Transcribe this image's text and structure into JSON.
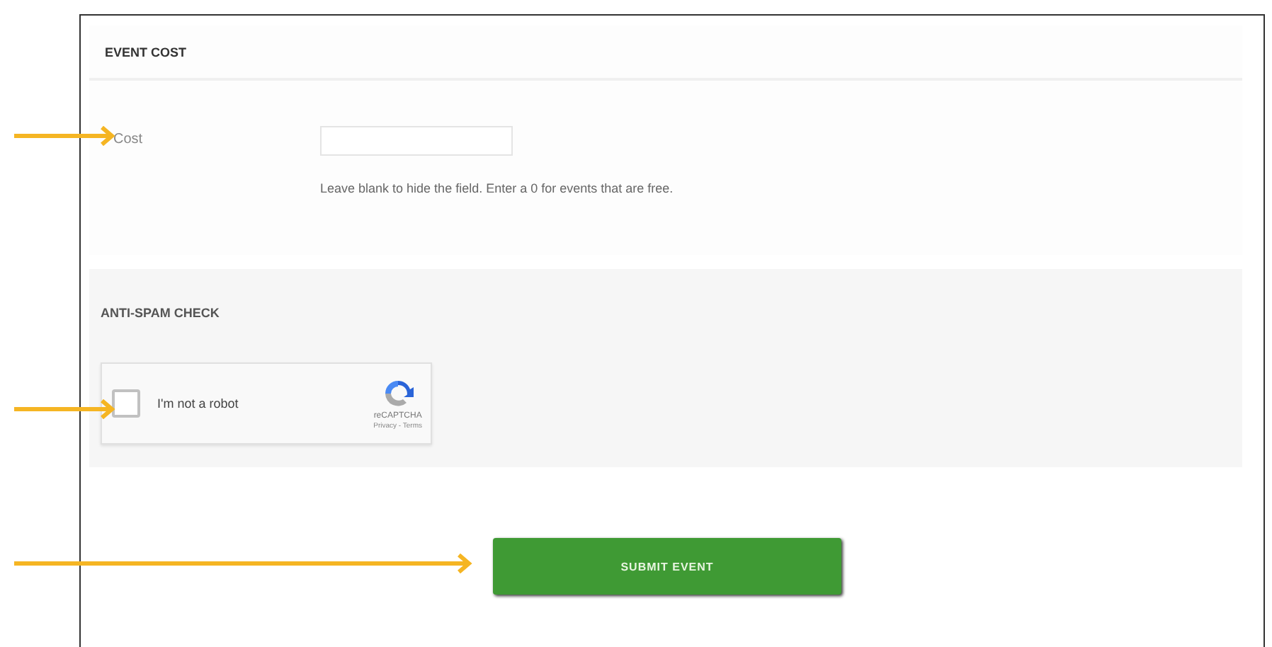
{
  "event_cost": {
    "title": "EVENT COST",
    "field": {
      "label": "Cost",
      "help": "Leave blank to hide the field. Enter a 0 for events that are free."
    }
  },
  "anti_spam": {
    "title": "ANTI-SPAM CHECK",
    "captcha": {
      "label": "I'm not a robot",
      "checked": false,
      "brand": "reCAPTCHA",
      "links": "Privacy - Terms"
    }
  },
  "submit": {
    "label": "SUBMIT EVENT"
  }
}
